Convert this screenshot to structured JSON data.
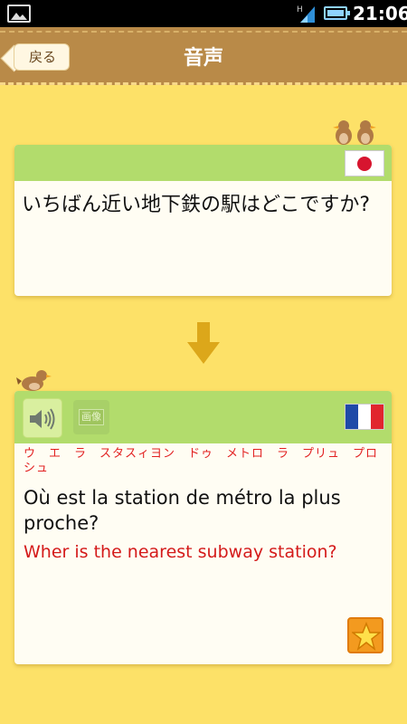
{
  "status_bar": {
    "time": "21:06",
    "network": "H",
    "icons": [
      "image-icon",
      "signal-icon",
      "battery-icon"
    ]
  },
  "header": {
    "back_label": "戻る",
    "title": "音声"
  },
  "source_card": {
    "flag": "japan-flag",
    "text": "いちばん近い地下鉄の駅はどこですか?"
  },
  "target_card": {
    "flag": "france-flag",
    "speaker_icon": "speaker-icon",
    "image_button_label": "画像",
    "reading": "ウ　エ　ラ　スタスィヨン　ドゥ　メトロ　ラ　プリュ　プロシュ",
    "french": "Où est la station de métro la plus proche?",
    "english": "Wher is the nearest subway station?"
  },
  "colors": {
    "background": "#fde168",
    "header": "#b98a48",
    "card_header": "#b2dc6c",
    "accent_red": "#d41a1a",
    "star": "#f39a1f"
  }
}
